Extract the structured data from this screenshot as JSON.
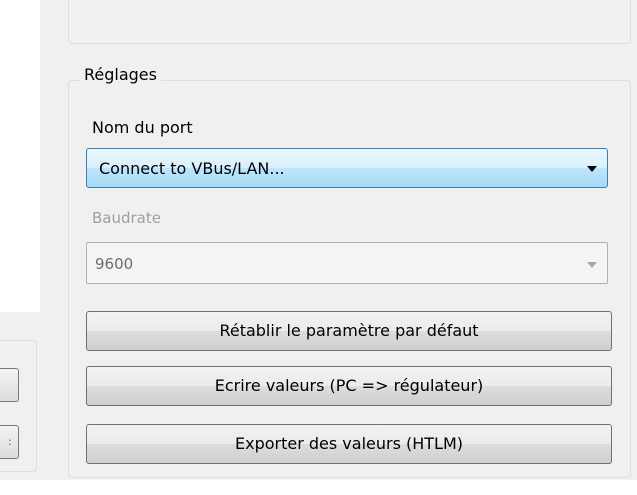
{
  "settings": {
    "group_title": "Réglages",
    "port_label": "Nom du port",
    "port_value": "Connect to VBus/LAN...",
    "baudrate_label": "Baudrate",
    "baudrate_value": "9600"
  },
  "buttons": {
    "reset": "Rétablir le paramètre par défaut",
    "write": "Ecrire valeurs (PC => régulateur)",
    "export": "Exporter des valeurs (HTLM)"
  },
  "icons": {
    "port_dropdown": "chevron-down-icon",
    "baudrate_dropdown": "chevron-down-icon"
  }
}
